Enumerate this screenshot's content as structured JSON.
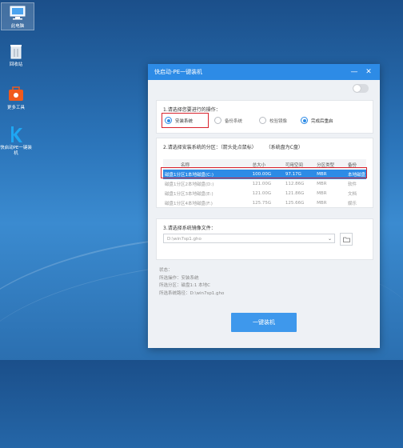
{
  "desktop": {
    "icons": [
      {
        "label": "此电脑",
        "icon": "computer-icon"
      },
      {
        "label": "回收站",
        "icon": "recycle-bin-icon"
      },
      {
        "label": "更多工具",
        "icon": "toolbox-icon"
      },
      {
        "label": "快启动PE一键装机",
        "icon": "kuaiqidong-k-icon"
      }
    ]
  },
  "window": {
    "title": "快启动-PE一键装机",
    "minimize": "—",
    "close": "✕",
    "section1": {
      "title": "1.请选择您要进行的操作：",
      "options": [
        {
          "label": "安装系统",
          "selected": true
        },
        {
          "label": "备份系统",
          "selected": false
        },
        {
          "label": "校验镜像",
          "selected": false
        },
        {
          "label": "完成后重启",
          "selected": true
        }
      ]
    },
    "section2": {
      "title": "2.请选择安装系统的分区：（箭头处点鼠标）",
      "hint": "（系统盘为C盘）",
      "headers": [
        "名称",
        "总大小",
        "可用空间",
        "分区类型",
        "备份"
      ],
      "rows": [
        [
          "磁盘1分区1本地磁盘(C:)",
          "100.00G",
          "97.17G",
          "MBR",
          "本地磁盘"
        ],
        [
          "磁盘1分区2本地磁盘(D:)",
          "121.00G",
          "112.86G",
          "MBR",
          "软件"
        ],
        [
          "磁盘1分区3本地磁盘(E:)",
          "121.00G",
          "121.86G",
          "MBR",
          "文档"
        ],
        [
          "磁盘1分区4本地磁盘(F:)",
          "125.75G",
          "125.66G",
          "MBR",
          "娱乐"
        ]
      ]
    },
    "section3": {
      "title": "3.请选择系统镜像文件：",
      "value": "D:\\win7sp1.gho"
    },
    "info": {
      "lines": [
        "状态：",
        "所选操作：安装系统",
        "所选分区：磁盘1:1  本地C",
        "所选系统路径：D:\\win7sp1.gho"
      ]
    },
    "install_button": "一键装机"
  },
  "colors": {
    "accent": "#2d8be6",
    "highlight": "#d9232d"
  }
}
